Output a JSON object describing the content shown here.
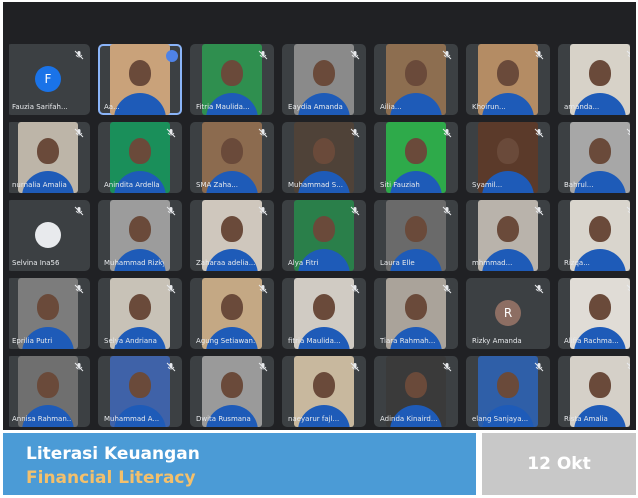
{
  "meeting": {
    "participants": [
      {
        "name": "Fauzia Sarifah...",
        "initial": "F",
        "avatar_color": "#1a73e8",
        "camera": false
      },
      {
        "name": "Aa...",
        "camera": true,
        "active": true,
        "bg": "#c9a27a"
      },
      {
        "name": "Fitria Maulida...",
        "camera": true,
        "bg": "#2f8f4f"
      },
      {
        "name": "Eaydia Amanda",
        "camera": true,
        "bg": "#8a8a8a"
      },
      {
        "name": "Ailia...",
        "camera": true,
        "bg": "#8d6e50"
      },
      {
        "name": "Khoirun...",
        "camera": true,
        "bg": "#b48c64"
      },
      {
        "name": "amanda...",
        "camera": true,
        "bg": "#d7d2c8"
      },
      {
        "name": "nurnalia Amalia",
        "camera": true,
        "bg": "#bdb5a8"
      },
      {
        "name": "Anindita Ardella",
        "camera": true,
        "bg": "#1a8f5a"
      },
      {
        "name": "SMA Zaha...",
        "camera": true,
        "bg": "#8c6b4f"
      },
      {
        "name": "Muhammad S...",
        "camera": true,
        "bg": "#4f4238"
      },
      {
        "name": "Siti Fauziah",
        "camera": true,
        "bg": "#2eaa4a"
      },
      {
        "name": "Syamil...",
        "camera": true,
        "bg": "#5b3a2a"
      },
      {
        "name": "Bahrul...",
        "camera": true,
        "bg": "#a7a7a7"
      },
      {
        "name": "Selvina Ina56",
        "camera": false,
        "avatar_color": "#e8eaed",
        "initial": ""
      },
      {
        "name": "Muhammad Rizky...",
        "camera": true,
        "bg": "#9c9c9c"
      },
      {
        "name": "Zaharaa adelia...",
        "camera": true,
        "bg": "#cfc7bd"
      },
      {
        "name": "Alya Fitri",
        "camera": true,
        "bg": "#2a7f4a"
      },
      {
        "name": "Laura Elle",
        "camera": true,
        "bg": "#6a6a6a"
      },
      {
        "name": "mhmmad...",
        "camera": true,
        "bg": "#b9b3ab"
      },
      {
        "name": "Rizqa...",
        "camera": true,
        "bg": "#d9d5cd"
      },
      {
        "name": "Eprilia Putri",
        "camera": true,
        "bg": "#7c7c7c"
      },
      {
        "name": "Selya Andriana",
        "camera": true,
        "bg": "#c8c2b7"
      },
      {
        "name": "Agung Setiawan...",
        "camera": true,
        "bg": "#c4a884"
      },
      {
        "name": "fitria Maulida...",
        "camera": true,
        "bg": "#d0cbc3"
      },
      {
        "name": "Tiara Rahmah...",
        "camera": true,
        "bg": "#aaa39a"
      },
      {
        "name": "Rizky Amanda",
        "camera": false,
        "initial": "R",
        "avatar_color": "#8d6e63"
      },
      {
        "name": "Alifia Rachma...",
        "camera": true,
        "bg": "#e0dcd6"
      },
      {
        "name": "Annisa Rahman...",
        "camera": true,
        "bg": "#6f6f6f"
      },
      {
        "name": "Muhammad A...",
        "camera": true,
        "bg": "#3f62a8"
      },
      {
        "name": "Dwita Rusmana",
        "camera": true,
        "bg": "#9a9a9a"
      },
      {
        "name": "naeyarur fajl...",
        "camera": true,
        "bg": "#c8b89e"
      },
      {
        "name": "Adinda Kinaird...",
        "camera": true,
        "bg": "#3a3a3a"
      },
      {
        "name": "elang Sanjaya...",
        "camera": true,
        "bg": "#2f5fa8"
      },
      {
        "name": "Rista Amalia",
        "camera": true,
        "bg": "#d5d0c8"
      }
    ]
  },
  "banner": {
    "title": "Literasi Keuangan",
    "subtitle": "Financial Literacy",
    "date": "12 Okt"
  },
  "colors": {
    "banner_bg": "#4b9bd6",
    "subtitle": "#f3c06c",
    "date_bg": "#c8c8c8",
    "meet_bg": "#202124"
  },
  "icons": {
    "mic_muted": "mic-off-icon",
    "more": "more-options-icon"
  }
}
